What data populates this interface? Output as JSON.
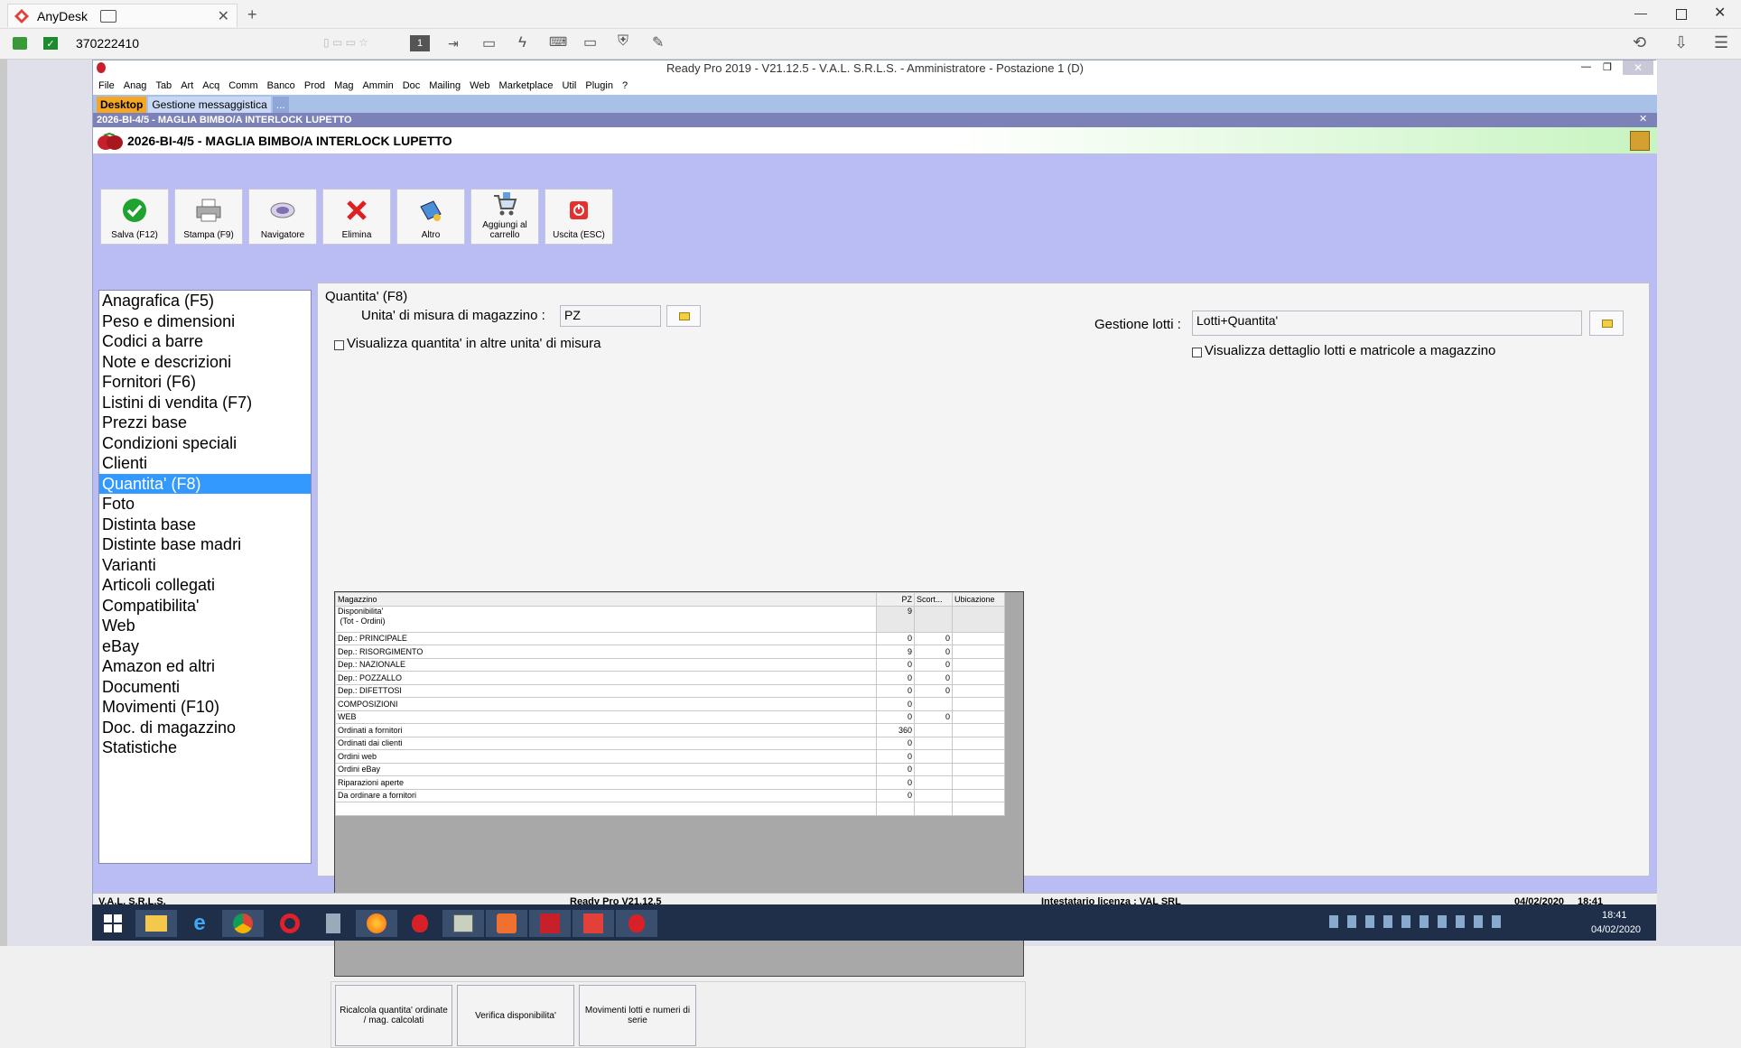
{
  "anydesk": {
    "tab_title": "AnyDesk",
    "address": "370222410"
  },
  "app": {
    "window_title": "Ready Pro 2019 - V21.12.5 - V.A.L. S.R.L.S. - Amministratore - Postazione 1 (D)",
    "menu": [
      "File",
      "Anag",
      "Tab",
      "Art",
      "Acq",
      "Comm",
      "Banco",
      "Prod",
      "Mag",
      "Ammin",
      "Doc",
      "Mailing",
      "Web",
      "Marketplace",
      "Util",
      "Plugin",
      "?"
    ],
    "tabs": [
      "Desktop",
      "Gestione messaggistica",
      "..."
    ],
    "doc_header": "2026-BI-4/5 - MAGLIA BIMBO/A INTERLOCK LUPETTO",
    "doc_title": "2026-BI-4/5 - MAGLIA BIMBO/A INTERLOCK LUPETTO"
  },
  "toolbar": [
    {
      "label": "Salva (F12)",
      "icon": "check-icon"
    },
    {
      "label": "Stampa (F9)",
      "icon": "printer-icon"
    },
    {
      "label": "Navigatore",
      "icon": "navigator-icon"
    },
    {
      "label": "Elimina",
      "icon": "delete-x-icon"
    },
    {
      "label": "Altro",
      "icon": "altro-icon"
    },
    {
      "label": "Aggiungi al carrello",
      "icon": "cart-icon"
    },
    {
      "label": "Uscita (ESC)",
      "icon": "exit-icon"
    }
  ],
  "sections": [
    "Anagrafica (F5)",
    "Peso e dimensioni",
    "Codici a barre",
    "Note e descrizioni",
    "Fornitori (F6)",
    "Listini di vendita (F7)",
    "Prezzi base",
    "Condizioni speciali",
    "Clienti",
    "Quantita' (F8)",
    "Foto",
    "Distinta base",
    "Distinte base madri",
    "Varianti",
    "Articoli collegati",
    "Compatibilita'",
    "Web",
    "eBay",
    "Amazon ed altri",
    "Documenti",
    "Movimenti (F10)",
    "Doc. di magazzino",
    "Statistiche"
  ],
  "selected_section": "Quantita' (F8)",
  "quantita": {
    "group_title": "Quantita' (F8)",
    "um_label": "Unita' di misura di magazzino :",
    "um_value": "PZ",
    "visualizza_um_label": "Visualizza quantita' in altre unita' di misura",
    "lotti_label": "Gestione lotti :",
    "lotti_value": "Lotti+Quantita'",
    "visualizza_lotti_label": "Visualizza dettaglio lotti e matricole a magazzino",
    "table": {
      "headers": [
        "Magazzino",
        "PZ",
        "Scort...",
        "Ubicazione"
      ],
      "rows": [
        [
          "Disponibilita'\n (Tot - Ordini)",
          "9",
          "",
          ""
        ],
        [
          "Dep.: PRINCIPALE",
          "0",
          "0",
          ""
        ],
        [
          "Dep.: RISORGIMENTO",
          "9",
          "0",
          ""
        ],
        [
          "Dep.: NAZIONALE",
          "0",
          "0",
          ""
        ],
        [
          "Dep.: POZZALLO",
          "0",
          "0",
          ""
        ],
        [
          "Dep.: DIFETTOSI",
          "0",
          "0",
          ""
        ],
        [
          "COMPOSIZIONI",
          "0",
          "",
          ""
        ],
        [
          "WEB",
          "0",
          "0",
          ""
        ],
        [
          "Ordinati a fornitori",
          "360",
          "",
          ""
        ],
        [
          "Ordinati dai clienti",
          "0",
          "",
          ""
        ],
        [
          "Ordini web",
          "0",
          "",
          ""
        ],
        [
          "Ordini eBay",
          "0",
          "",
          ""
        ],
        [
          "Riparazioni aperte",
          "0",
          "",
          ""
        ],
        [
          "Da ordinare a fornitori",
          "0",
          "",
          ""
        ],
        [
          "",
          "",
          "",
          ""
        ]
      ]
    },
    "buttons": [
      "Ricalcola quantita' ordinate / mag. calcolati",
      "Verifica disponibilita'",
      "Movimenti lotti e numeri di serie"
    ]
  },
  "statusbar": {
    "company": "V.A.L. S.R.L.S.",
    "version": "Ready Pro V21.12.5",
    "license": "Intestatario licenza : VAL SRL",
    "date": "04/02/2020",
    "time": "18:41"
  },
  "taskbar": {
    "clock_time": "18:41",
    "clock_date": "04/02/2020"
  }
}
